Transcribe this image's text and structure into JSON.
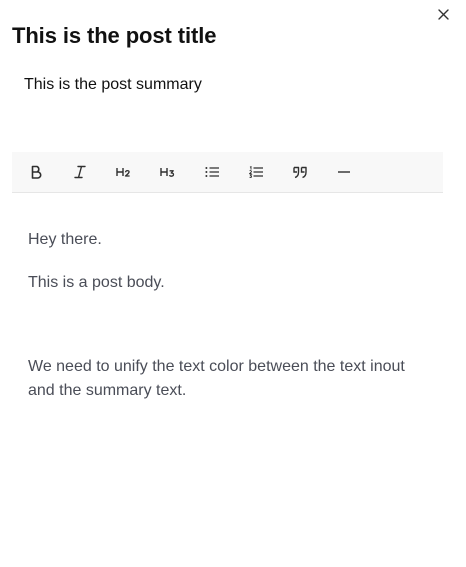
{
  "window": {
    "close_icon": "close-icon"
  },
  "post": {
    "title": "This is the post title",
    "summary_value": "This is the post summary"
  },
  "toolbar": {
    "buttons": [
      {
        "name": "bold",
        "icon": "bold-icon",
        "glyph": "B"
      },
      {
        "name": "italic",
        "icon": "italic-icon",
        "glyph": "I"
      },
      {
        "name": "heading-2",
        "icon": "heading-2-icon",
        "glyph": "H2"
      },
      {
        "name": "heading-3",
        "icon": "heading-3-icon",
        "glyph": "H3"
      },
      {
        "name": "bullet-list",
        "icon": "bullet-list-icon"
      },
      {
        "name": "ordered-list",
        "icon": "ordered-list-icon"
      },
      {
        "name": "blockquote",
        "icon": "quote-icon"
      },
      {
        "name": "horizontal-rule",
        "icon": "horizontal-rule-icon"
      }
    ]
  },
  "body": {
    "paragraphs": [
      "Hey there.",
      "This is a post body.",
      "We need to unify the text color between the text inout and the summary text."
    ]
  },
  "colors": {
    "title": "#111111",
    "summary": "#111111",
    "body_text": "#4a4d57",
    "toolbar_bg": "#f8f8f8",
    "toolbar_border": "#e6e6e6"
  }
}
